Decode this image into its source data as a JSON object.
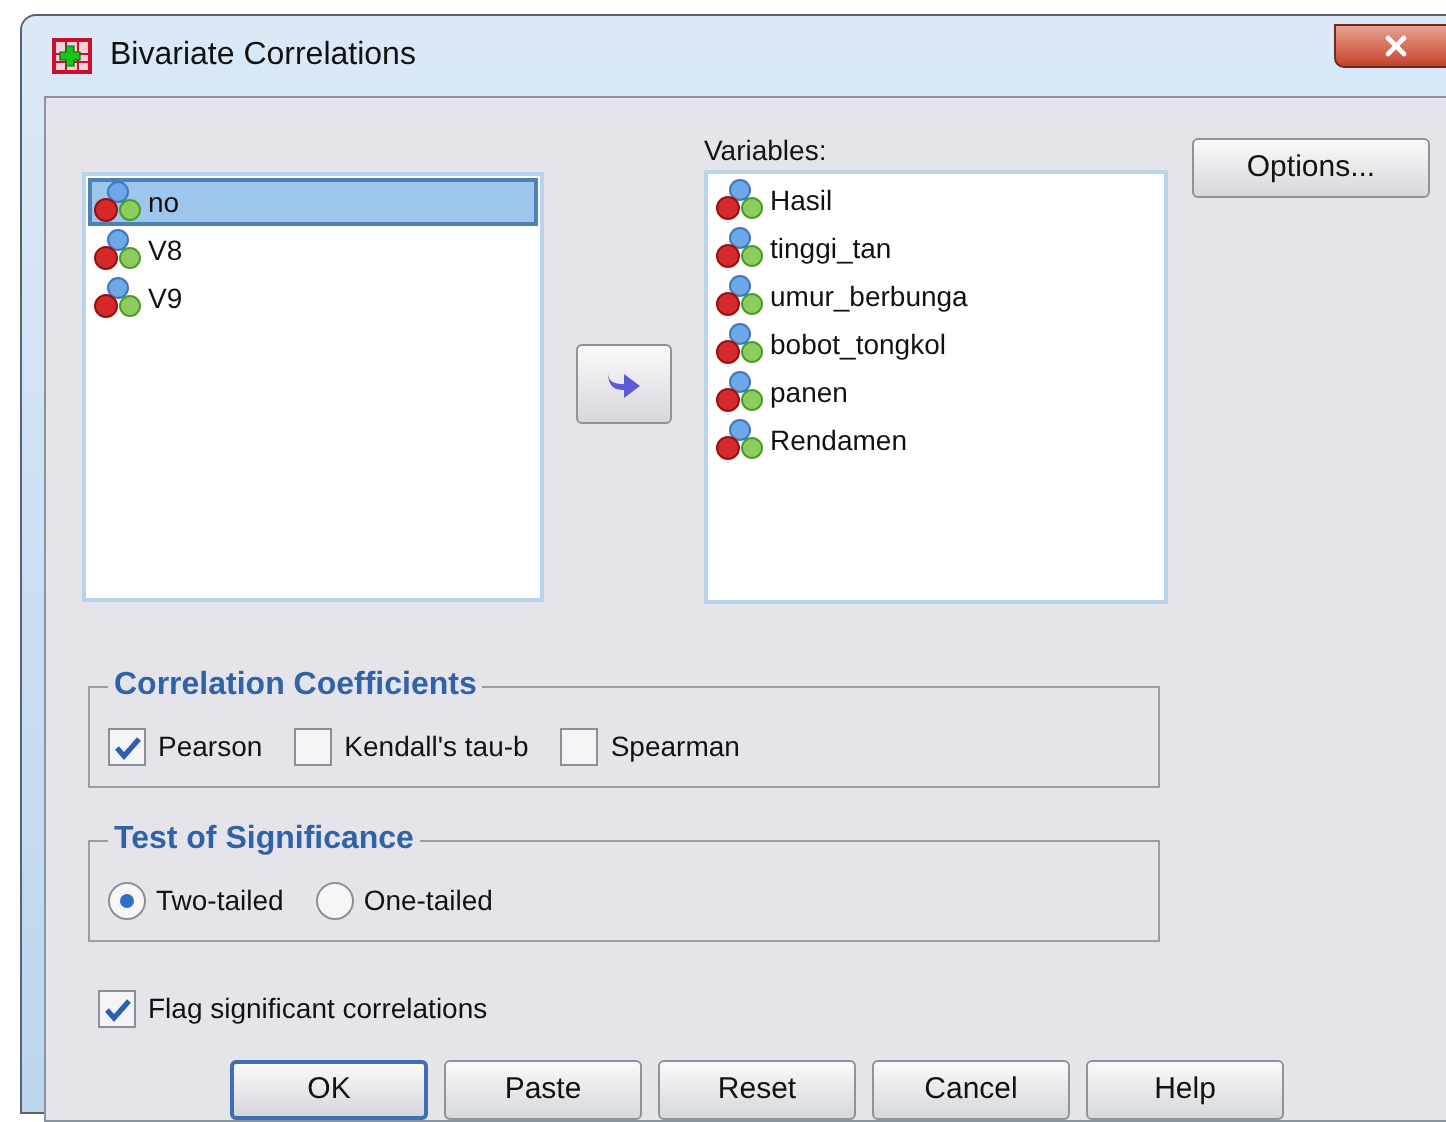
{
  "window": {
    "title": "Bivariate Correlations"
  },
  "source_list": {
    "items": [
      {
        "name": "no",
        "selected": true
      },
      {
        "name": "V8",
        "selected": false
      },
      {
        "name": "V9",
        "selected": false
      }
    ]
  },
  "variables": {
    "label": "Variables:",
    "items": [
      {
        "name": "Hasil",
        "selected": false
      },
      {
        "name": "tinggi_tan",
        "selected": false
      },
      {
        "name": "umur_berbunga",
        "selected": false
      },
      {
        "name": "bobot_tongkol",
        "selected": false
      },
      {
        "name": "panen",
        "selected": false
      },
      {
        "name": "Rendamen",
        "selected": false
      }
    ]
  },
  "options_button": "Options...",
  "correlation_coefficients": {
    "title": "Correlation Coefficients",
    "options": [
      {
        "label": "Pearson",
        "checked": true
      },
      {
        "label": "Kendall's tau-b",
        "checked": false
      },
      {
        "label": "Spearman",
        "checked": false
      }
    ]
  },
  "test_of_significance": {
    "title": "Test of Significance",
    "options": [
      {
        "label": "Two-tailed",
        "selected": true
      },
      {
        "label": "One-tailed",
        "selected": false
      }
    ]
  },
  "flag": {
    "label": "Flag significant correlations",
    "checked": true
  },
  "buttons": [
    {
      "label": "OK",
      "default": true
    },
    {
      "label": "Paste",
      "default": false
    },
    {
      "label": "Reset",
      "default": false
    },
    {
      "label": "Cancel",
      "default": false
    },
    {
      "label": "Help",
      "default": false
    }
  ]
}
